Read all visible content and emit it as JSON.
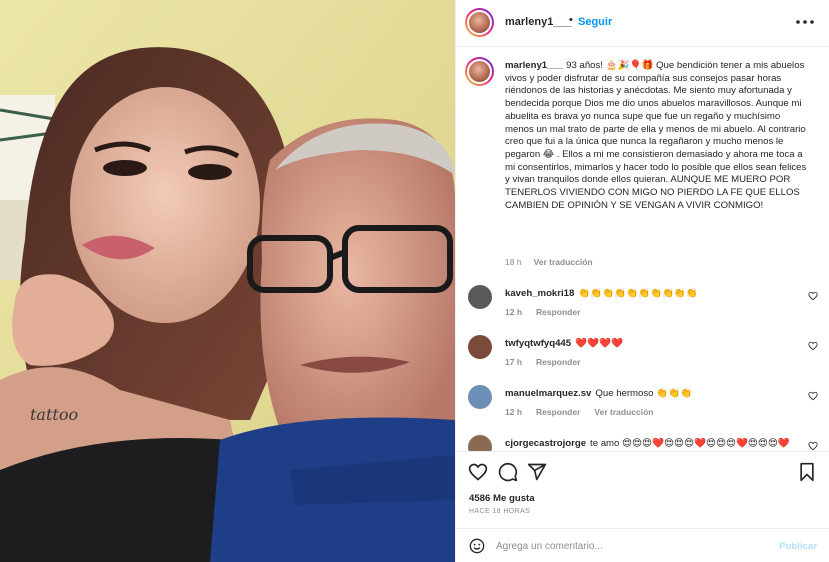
{
  "header": {
    "username": "marleny1___",
    "separator": "•",
    "follow_label": "Seguir",
    "more_icon": "ellipsis-icon"
  },
  "caption": {
    "username": "marleny1___",
    "text": "93 años! 🎂🎉🎈🎁 Que bendición tener a mis abuelos vivos y poder disfrutar de su compañía sus consejos pasar horas riéndonos de las historias y anécdotas. Me siento muy afortunada y bendecida porque Dios me dio unos abuelos maravillosos. Aunque mi abuelita es brava yo nunca supe que fue un regaño y muchísimo menos un mal trato de parte de ella y menos de mi abuelo. Al contrario creo que fui a la única que nunca la regañaron y mucho menos le pegaron 😂 . Ellos a mi me consistieron demasiado y ahora me toca a mi consentirlos, mimarlos y hacer todo lo posible que ellos sean felices y vivan tranquilos donde ellos quieran. AUNQUE ME MUERO POR TENERLOS VIVIENDO CON MIGO NO PIERDO LA FE QUE ELLOS CAMBIEN DE OPINIÓN Y SE VENGAN A VIVIR CONMIGO!",
    "time": "18 h",
    "translate_label": "Ver traducción"
  },
  "comments": [
    {
      "username": "kaveh_mokri18",
      "text": "👏👏👏👏👏👏👏👏👏👏",
      "time": "12 h",
      "reply_label": "Responder",
      "translate_label": "",
      "avatar_color": "#5a5a5a"
    },
    {
      "username": "twfyqtwfyq445",
      "text": "❤️❤️❤️❤️",
      "time": "17 h",
      "reply_label": "Responder",
      "translate_label": "",
      "avatar_color": "#7a4a3a"
    },
    {
      "username": "manuelmarquez.sv",
      "text": "Que hermoso 👏👏👏",
      "time": "12 h",
      "reply_label": "Responder",
      "translate_label": "Ver traducción",
      "avatar_color": "#6b8fb5"
    },
    {
      "username": "cjorgecastrojorge",
      "text": "te amo 😍😍😍❤️😍😍😍❤️😍😍😍❤️😍😍😍❤️",
      "time": "",
      "reply_label": "",
      "translate_label": "",
      "avatar_color": "#8a6a50"
    }
  ],
  "actions": {
    "like_icon": "heart-icon",
    "comment_icon": "comment-bubble-icon",
    "share_icon": "paper-plane-icon",
    "save_icon": "bookmark-icon"
  },
  "likes": "4586 Me gusta",
  "time_ago": "HACE 18 HORAS",
  "add_comment": {
    "placeholder": "Agrega un comentario...",
    "publish_label": "Publicar",
    "emoji_icon": "smiley-icon"
  },
  "colors": {
    "link_blue": "#0095f6",
    "publish_disabled": "#b2dffc",
    "muted": "#8e8e8e",
    "wall_yellow": "#e9e2a0"
  }
}
